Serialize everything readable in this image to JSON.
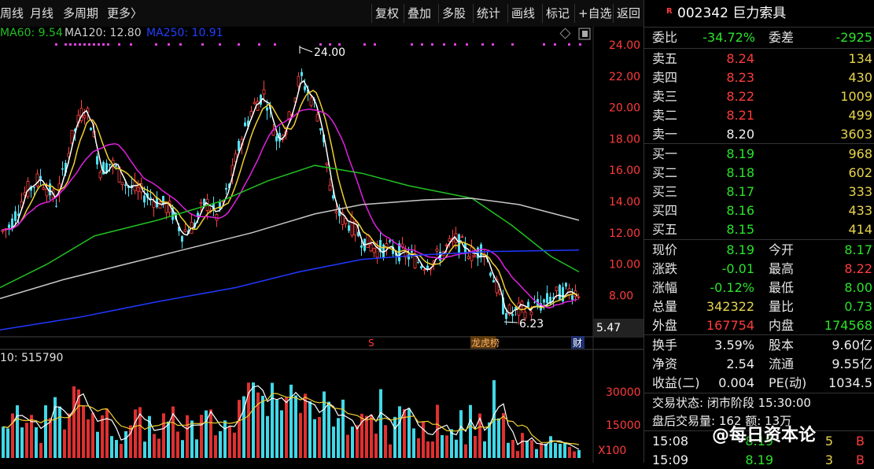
{
  "toolbar": {
    "left_items": [
      "周线",
      "月线",
      "多周期",
      "更多〉"
    ],
    "right_items": [
      "复权",
      "叠加",
      "多股",
      "统计",
      "画线",
      "标记",
      "+自选",
      "返回"
    ]
  },
  "ma_legend": [
    {
      "label": "MA60: 9.54",
      "color": "#21c021"
    },
    {
      "label": "MA120: 12.80",
      "color": "#cfcfcf"
    },
    {
      "label": "MA250: 10.91",
      "color": "#2240ff"
    }
  ],
  "price_axis": [
    "24.00",
    "22.00",
    "20.00",
    "18.00",
    "16.00",
    "14.00",
    "12.00",
    "10.00",
    "8.00"
  ],
  "price_axis_values": [
    24,
    22,
    20,
    18,
    16,
    14,
    12,
    10,
    8
  ],
  "current_price_tag": "5.47",
  "annotations": {
    "high": "24.00",
    "low": "6.23",
    "markers": [
      "S",
      "龙虎榜",
      "财"
    ]
  },
  "volume": {
    "legend": "10: 515790",
    "axis": [
      "30000",
      "15000"
    ],
    "unit": "X100"
  },
  "stock": {
    "badge": "R",
    "code_name": "002342 巨力索具"
  },
  "orderbook": {
    "weibi": {
      "label": "委比",
      "value": "-34.72%"
    },
    "weicha": {
      "label": "委差",
      "value": "-2925"
    },
    "sell": [
      {
        "label": "卖五",
        "price": "8.24",
        "vol": "134",
        "color": "#ff3b3b"
      },
      {
        "label": "卖四",
        "price": "8.23",
        "vol": "430",
        "color": "#ff3b3b"
      },
      {
        "label": "卖三",
        "price": "8.22",
        "vol": "1009",
        "color": "#ff3b3b"
      },
      {
        "label": "卖二",
        "price": "8.21",
        "vol": "499",
        "color": "#ff3b3b"
      },
      {
        "label": "卖一",
        "price": "8.20",
        "vol": "3603",
        "color": "#f0f0f0"
      }
    ],
    "buy": [
      {
        "label": "买一",
        "price": "8.19",
        "vol": "968",
        "color": "#2be22b"
      },
      {
        "label": "买二",
        "price": "8.18",
        "vol": "602",
        "color": "#2be22b"
      },
      {
        "label": "买三",
        "price": "8.17",
        "vol": "333",
        "color": "#2be22b"
      },
      {
        "label": "买四",
        "price": "8.16",
        "vol": "433",
        "color": "#2be22b"
      },
      {
        "label": "买五",
        "price": "8.15",
        "vol": "414",
        "color": "#2be22b"
      }
    ]
  },
  "quote": [
    [
      {
        "l": "现价",
        "v": "8.19",
        "c": "#2be22b"
      },
      {
        "l": "今开",
        "v": "8.17",
        "c": "#2be22b"
      }
    ],
    [
      {
        "l": "涨跌",
        "v": "-0.01",
        "c": "#2be22b"
      },
      {
        "l": "最高",
        "v": "8.22",
        "c": "#ff3b3b"
      }
    ],
    [
      {
        "l": "涨幅",
        "v": "-0.12%",
        "c": "#2be22b"
      },
      {
        "l": "最低",
        "v": "8.00",
        "c": "#2be22b"
      }
    ],
    [
      {
        "l": "总量",
        "v": "342322",
        "c": "#e8d54a"
      },
      {
        "l": "量比",
        "v": "0.73",
        "c": "#2be22b"
      }
    ],
    [
      {
        "l": "外盘",
        "v": "167754",
        "c": "#ff3b3b"
      },
      {
        "l": "内盘",
        "v": "174568",
        "c": "#2be22b"
      }
    ]
  ],
  "stats": [
    [
      {
        "l": "换手",
        "v": "3.59%"
      },
      {
        "l": "股本",
        "v": "9.60亿"
      }
    ],
    [
      {
        "l": "净资",
        "v": "2.54"
      },
      {
        "l": "流通",
        "v": "9.55亿"
      }
    ],
    [
      {
        "l": "收益(二)",
        "v": "0.004"
      },
      {
        "l": "PE(动)",
        "v": "1034.5"
      }
    ]
  ],
  "status": {
    "line1": "交易状态: 闭市阶段 15:30:00",
    "line2": "盘后交易量: 162  额: 13万"
  },
  "ticks": [
    {
      "time": "15:08",
      "price": "8.19",
      "vol": "5",
      "side": "B"
    },
    {
      "time": "15:09",
      "price": "8.19",
      "vol": "3",
      "side": "B"
    }
  ],
  "watermark": "@每日资本论"
}
